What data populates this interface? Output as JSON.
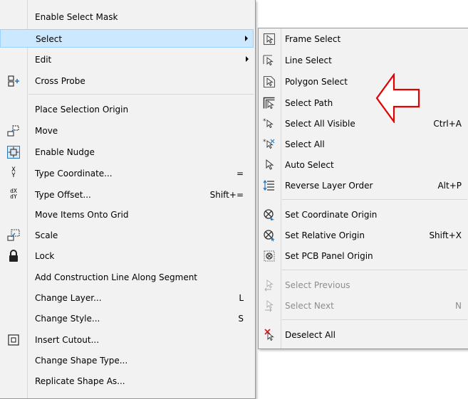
{
  "main_menu": {
    "items": [
      {
        "label": "Enable Select Mask"
      },
      {
        "label": "Select"
      },
      {
        "label": "Edit"
      },
      {
        "label": "Cross Probe",
        "icon": "cross-probe-icon"
      },
      {
        "label": "Place Selection Origin"
      },
      {
        "label": "Move",
        "icon": "move-icon"
      },
      {
        "label": "Enable Nudge",
        "icon": "nudge-icon"
      },
      {
        "label": "Type Coordinate...",
        "shortcut": "=",
        "icon": "xy-coordinate-icon",
        "icon_text": [
          "X",
          "Y"
        ]
      },
      {
        "label": "Type Offset...",
        "shortcut": "Shift+=",
        "icon": "dx-dy-offset-icon",
        "icon_text": [
          "dX",
          "dY"
        ]
      },
      {
        "label": "Move Items Onto Grid"
      },
      {
        "label": "Scale",
        "icon": "scale-icon"
      },
      {
        "label": "Lock",
        "icon": "lock-icon"
      },
      {
        "label": "Add Construction Line Along Segment"
      },
      {
        "label": "Change Layer...",
        "shortcut": "L"
      },
      {
        "label": "Change Style...",
        "shortcut": "S"
      },
      {
        "label": "Insert Cutout...",
        "icon": "cutout-icon"
      },
      {
        "label": "Change Shape Type..."
      },
      {
        "label": "Replicate Shape As..."
      }
    ]
  },
  "select_submenu": {
    "items": [
      {
        "label": "Frame Select",
        "icon": "frame-select-icon"
      },
      {
        "label": "Line Select",
        "icon": "line-select-icon"
      },
      {
        "label": "Polygon Select",
        "icon": "polygon-select-icon"
      },
      {
        "label": "Select Path",
        "icon": "select-path-icon"
      },
      {
        "label": "Select All Visible",
        "shortcut": "Ctrl+A",
        "icon": "select-all-visible-icon"
      },
      {
        "label": "Select All",
        "icon": "select-all-icon"
      },
      {
        "label": "Auto Select",
        "icon": "auto-select-icon"
      },
      {
        "label": "Reverse Layer Order",
        "shortcut": "Alt+P",
        "icon": "reverse-layer-order-icon"
      },
      {
        "label": "Set Coordinate Origin",
        "icon": "coordinate-origin-icon"
      },
      {
        "label": "Set Relative Origin",
        "shortcut": "Shift+X",
        "icon": "relative-origin-icon"
      },
      {
        "label": "Set PCB Panel Origin",
        "icon": "pcb-panel-origin-icon"
      },
      {
        "label": "Select Previous",
        "icon": "select-previous-icon",
        "disabled": true
      },
      {
        "label": "Select Next",
        "shortcut": "N",
        "icon": "select-next-icon",
        "disabled": true
      },
      {
        "label": "Deselect All",
        "icon": "deselect-all-icon"
      }
    ]
  },
  "colors": {
    "menu_background": "#f2f2f2",
    "highlight": "#cce8ff",
    "highlight_border": "#99d1ff",
    "disabled_text": "#8d8d8d",
    "callout_arrow": "#e00000"
  }
}
